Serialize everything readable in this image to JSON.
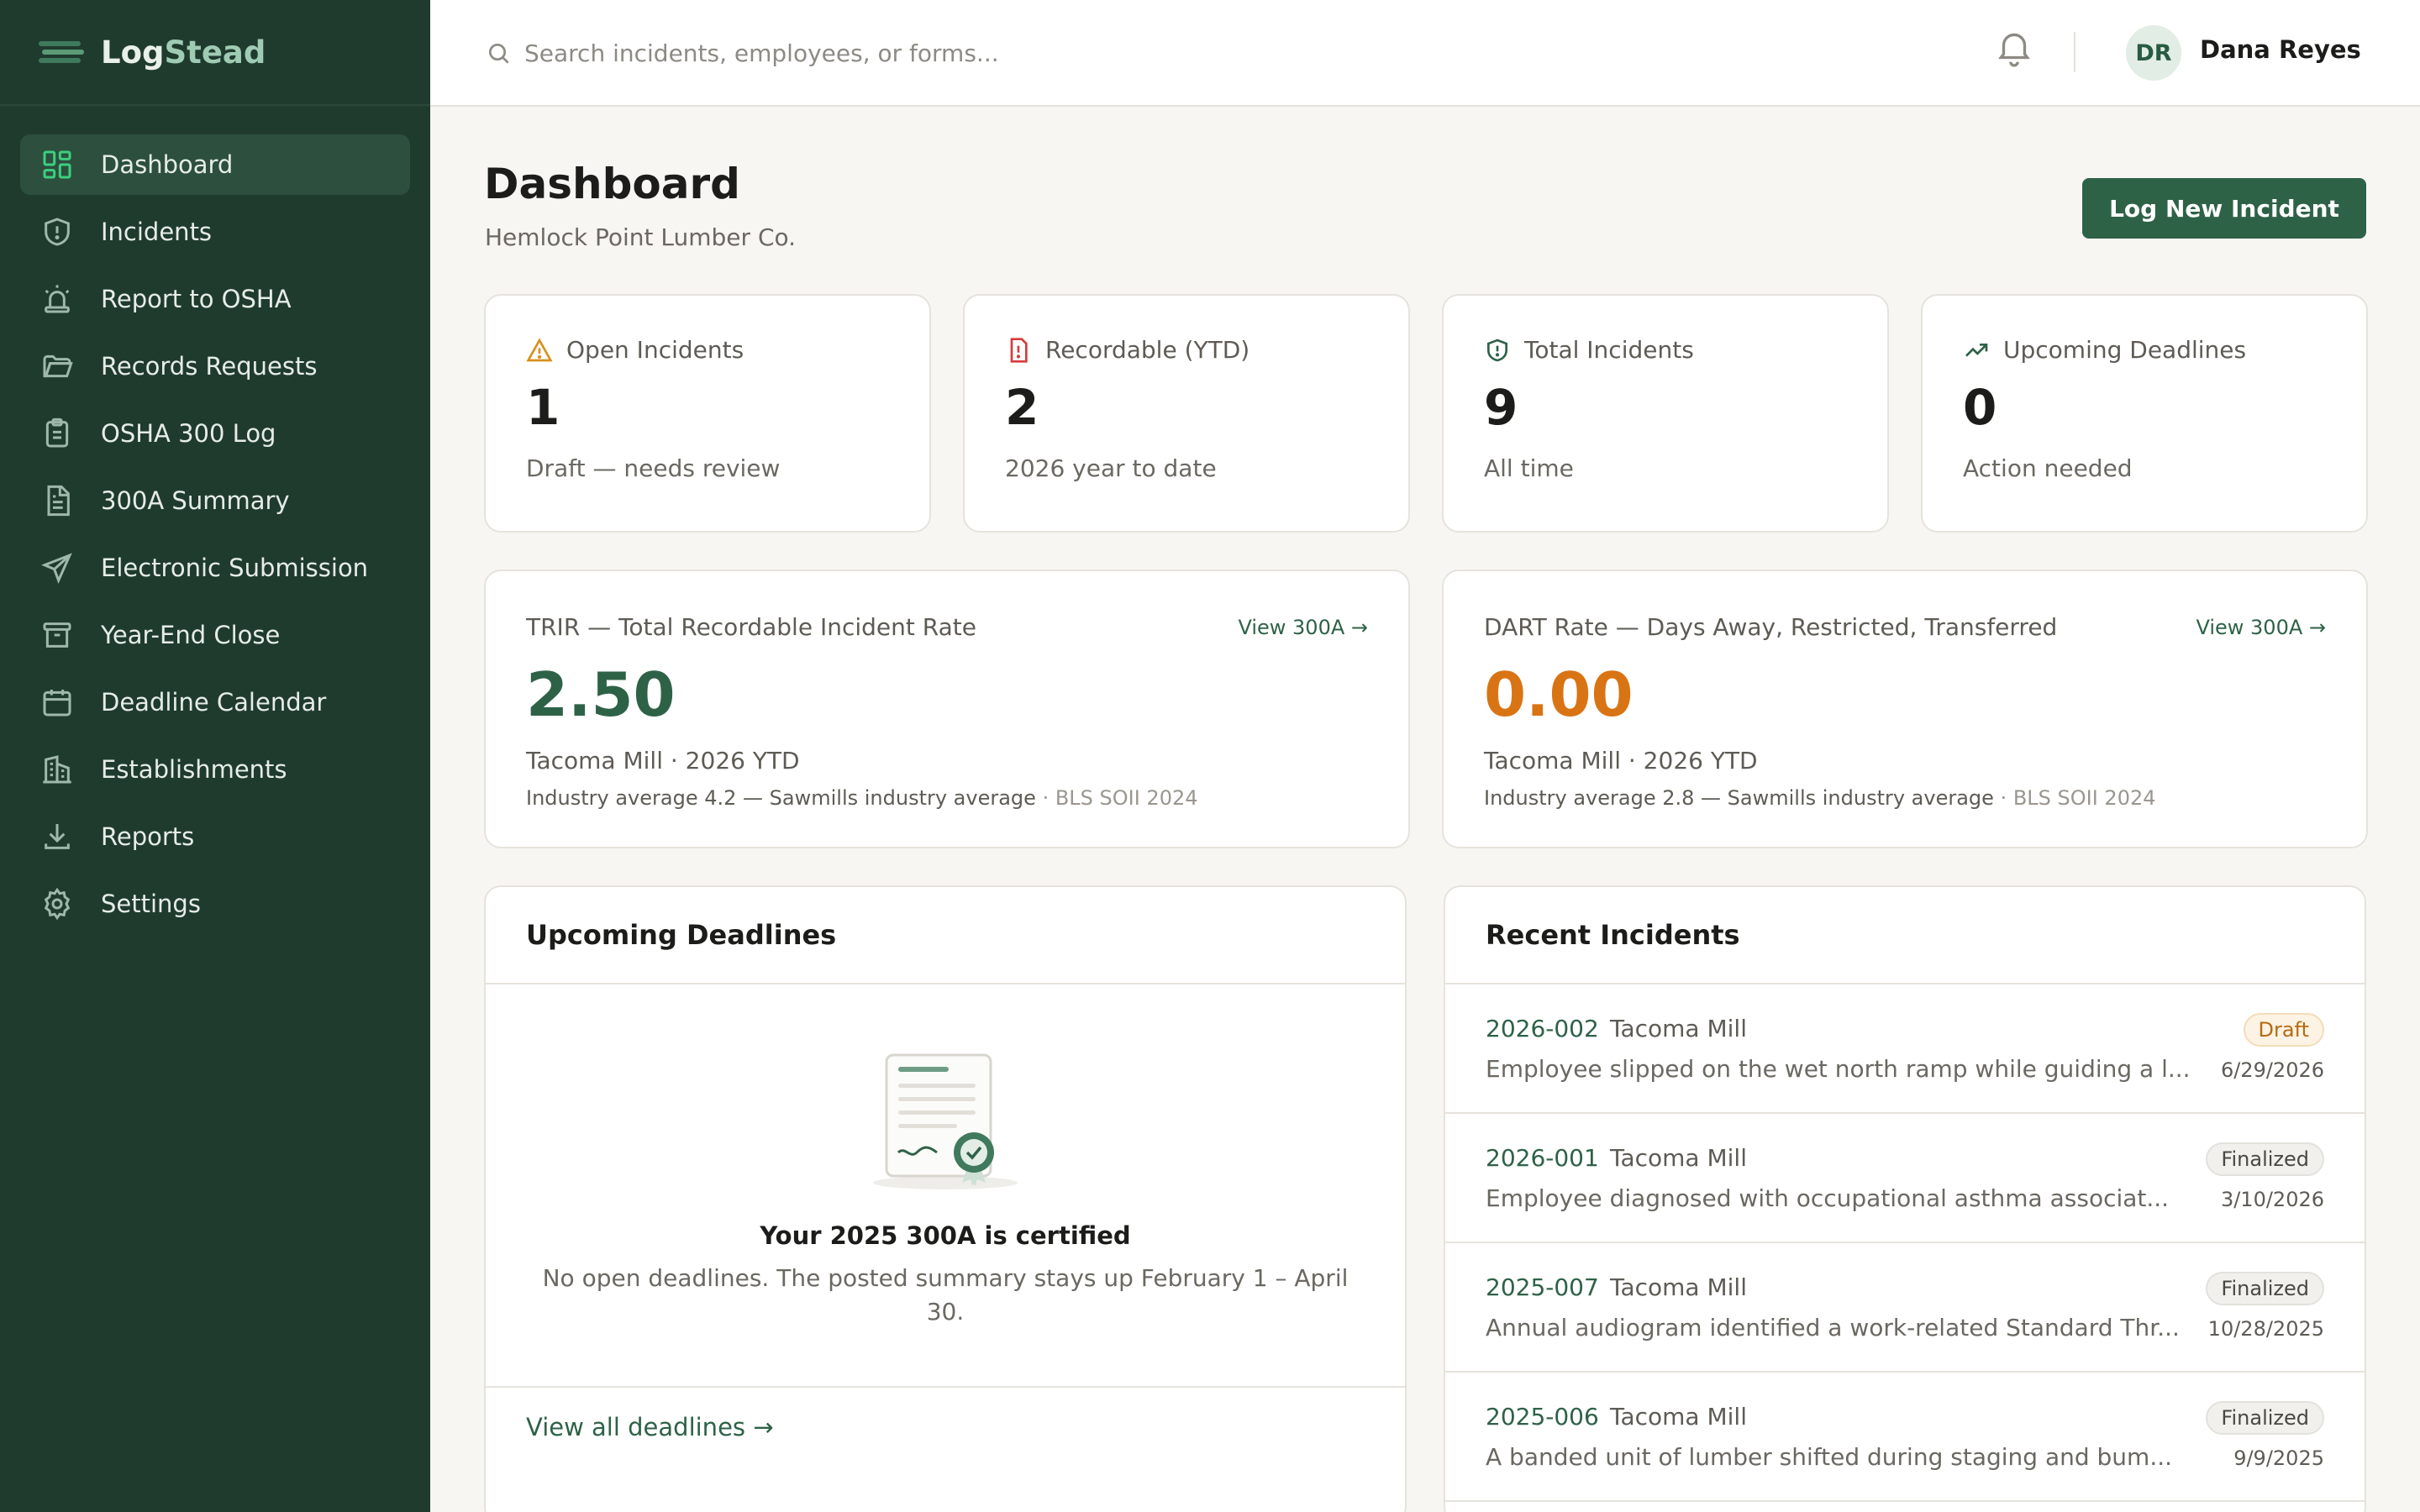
{
  "brand": {
    "part1": "Log",
    "part2": "Stead"
  },
  "sidebar": {
    "items": [
      {
        "label": "Dashboard",
        "icon": "dashboard-icon",
        "active": true
      },
      {
        "label": "Incidents",
        "icon": "shield-alert-icon"
      },
      {
        "label": "Report to OSHA",
        "icon": "siren-icon"
      },
      {
        "label": "Records Requests",
        "icon": "folder-open-icon"
      },
      {
        "label": "OSHA 300 Log",
        "icon": "clipboard-list-icon"
      },
      {
        "label": "300A Summary",
        "icon": "file-text-icon"
      },
      {
        "label": "Electronic Submission",
        "icon": "send-icon"
      },
      {
        "label": "Year-End Close",
        "icon": "archive-icon"
      },
      {
        "label": "Deadline Calendar",
        "icon": "calendar-icon"
      },
      {
        "label": "Establishments",
        "icon": "building-icon"
      },
      {
        "label": "Reports",
        "icon": "download-icon"
      },
      {
        "label": "Settings",
        "icon": "gear-icon"
      }
    ]
  },
  "topbar": {
    "search_placeholder": "Search incidents, employees, or forms...",
    "user_initials": "DR",
    "user_name": "Dana Reyes"
  },
  "header": {
    "title": "Dashboard",
    "subtitle": "Hemlock Point Lumber Co.",
    "primary_action": "Log New Incident"
  },
  "stats": [
    {
      "label": "Open Incidents",
      "value": "1",
      "caption": "Draft — needs review",
      "icon": "warning-triangle-icon",
      "color": "#d9901c"
    },
    {
      "label": "Recordable (YTD)",
      "value": "2",
      "caption": "2026 year to date",
      "icon": "file-alert-icon",
      "color": "#d63b3b"
    },
    {
      "label": "Total Incidents",
      "value": "9",
      "caption": "All time",
      "icon": "shield-icon",
      "color": "#2e6247"
    },
    {
      "label": "Upcoming Deadlines",
      "value": "0",
      "caption": "Action needed",
      "icon": "trending-up-icon",
      "color": "#2e6247"
    }
  ],
  "rates": [
    {
      "label": "TRIR — Total Recordable Incident Rate",
      "link": "View 300A →",
      "value": "2.50",
      "value_color": "#2e6247",
      "sub": "Tacoma Mill · 2026 YTD",
      "note": "Industry average 4.2 — Sawmills industry average",
      "source": " · BLS SOII 2024"
    },
    {
      "label": "DART Rate — Days Away, Restricted, Transferred",
      "link": "View 300A →",
      "value": "0.00",
      "value_color": "#d97414",
      "sub": "Tacoma Mill · 2026 YTD",
      "note": "Industry average 2.8 — Sawmills industry average",
      "source": " · BLS SOII 2024"
    }
  ],
  "deadlines": {
    "title": "Upcoming Deadlines",
    "empty_title": "Your 2025 300A is certified",
    "empty_text": "No open deadlines. The posted summary stays up February 1 – April 30.",
    "footer_link": "View all deadlines →"
  },
  "recent": {
    "title": "Recent Incidents",
    "items": [
      {
        "id": "2026-002",
        "site": "Tacoma Mill",
        "desc": "Employee slipped on the wet north ramp while guiding a l...",
        "status": "Draft",
        "date": "6/29/2026"
      },
      {
        "id": "2026-001",
        "site": "Tacoma Mill",
        "desc": "Employee diagnosed with occupational asthma associat...",
        "status": "Finalized",
        "date": "3/10/2026"
      },
      {
        "id": "2025-007",
        "site": "Tacoma Mill",
        "desc": "Annual audiogram identified a work-related Standard Thr...",
        "status": "Finalized",
        "date": "10/28/2025"
      },
      {
        "id": "2025-006",
        "site": "Tacoma Mill",
        "desc": "A banded unit of lumber shifted during staging and bum...",
        "status": "Finalized",
        "date": "9/9/2025"
      }
    ]
  },
  "colors": {
    "sidebar_bg": "#1f3b2e",
    "accent": "#2e6247",
    "warning": "#d97414",
    "danger": "#d63b3b"
  }
}
